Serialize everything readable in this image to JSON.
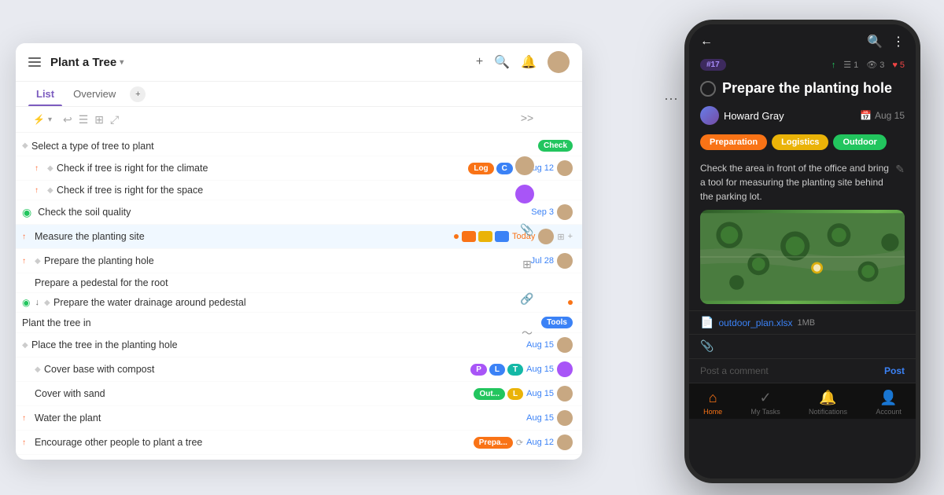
{
  "window": {
    "title": "Plant a Tree",
    "title_chevron": "▾",
    "tabs": [
      {
        "label": "List",
        "active": true
      },
      {
        "label": "Overview",
        "active": false
      }
    ],
    "header_icons": [
      "+",
      "🔍",
      "🔔"
    ],
    "filter_label": "⚡",
    "toolbar_icons": [
      "↩",
      "☰",
      "⊞",
      "⤢"
    ]
  },
  "tasks": [
    {
      "indent": 1,
      "arrow": "",
      "bullet": "◆",
      "name": "Select a type of tree to plant",
      "badge": "Check",
      "badge_color": "green",
      "date": "",
      "avatar": true,
      "avatar_color": "default"
    },
    {
      "indent": 2,
      "arrow": "↑",
      "bullet": "◆",
      "name": "Check if tree is right for the climate",
      "badge": "Log",
      "badge2": "C",
      "badge2_color": "blue",
      "date": "Aug 12",
      "avatar": true,
      "avatar_color": "default",
      "sync": true
    },
    {
      "indent": 2,
      "arrow": "↑",
      "bullet": "◆",
      "name": "Check if tree is right for the space",
      "badge": "",
      "date": "",
      "avatar": false
    },
    {
      "indent": 1,
      "arrow": "",
      "check_green": true,
      "name": "Check the soil quality",
      "date": "Sep 3",
      "avatar": true,
      "avatar_color": "default"
    },
    {
      "indent": 1,
      "arrow": "↑",
      "name": "Measure the planting site",
      "dot": true,
      "badges_color": [
        "orange",
        "orange",
        "blue"
      ],
      "date": "Today",
      "date_color": "orange",
      "avatar": true,
      "avatar_color": "default",
      "actions": true,
      "highlighted": true
    },
    {
      "indent": 1,
      "arrow": "↑",
      "bullet": "◆",
      "name": "Prepare the planting hole",
      "date": "Jul 28",
      "avatar": true,
      "avatar_color": "default"
    },
    {
      "indent": 2,
      "arrow": "",
      "name": "Prepare a pedestal for the root",
      "date": "",
      "avatar": false
    },
    {
      "indent": 1,
      "arrow": "",
      "check_green": true,
      "check_down": true,
      "bullet": "◆",
      "name": "Prepare the water drainage around pedestal",
      "dot_orange": true,
      "date": "",
      "avatar": false
    },
    {
      "indent": 1,
      "arrow": "",
      "name": "Plant the tree in",
      "badge": "Tools",
      "badge_color": "blue",
      "date": "",
      "avatar": false
    },
    {
      "indent": 1,
      "arrow": "",
      "bullet": "◆",
      "name": "Place the tree in the planting hole",
      "date": "Aug 15",
      "avatar": true,
      "avatar_color": "default"
    },
    {
      "indent": 2,
      "arrow": "",
      "bullet": "◆",
      "name": "Cover base with compost",
      "badges": [
        "P",
        "L",
        "T"
      ],
      "badges_colors": [
        "purple",
        "blue",
        "teal"
      ],
      "date": "Aug 15",
      "avatar": true,
      "avatar_color": "purple"
    },
    {
      "indent": 2,
      "arrow": "",
      "name": "Cover with sand",
      "badge": "Out...",
      "badge2": "L",
      "badge2_color": "yellow",
      "date": "Aug 15",
      "avatar": true,
      "avatar_color": "default"
    },
    {
      "indent": 1,
      "arrow": "↑",
      "name": "Water the plant",
      "date": "Aug 15",
      "avatar": true,
      "avatar_color": "default"
    },
    {
      "indent": 1,
      "arrow": "",
      "name": "Encourage other people to plant a tree",
      "badge": "Prepa...",
      "badge_color": "orange",
      "date": "Aug 12",
      "avatar": true,
      "avatar_color": "default",
      "sync": true
    }
  ],
  "phone": {
    "task_id": "#17",
    "stats": {
      "up": "↑",
      "list_count": "1",
      "eye_count": "3",
      "heart_count": "5"
    },
    "task_title": "Prepare the planting hole",
    "assignee": "Howard Gray",
    "date": "Aug 15",
    "calendar_icon": "📅",
    "labels": [
      "Preparation",
      "Logistics",
      "Outdoor"
    ],
    "label_colors": [
      "orange",
      "yellow",
      "green"
    ],
    "description": "Check the area in front of the office and bring a tool for measuring the planting site behind the parking lot.",
    "attachment_name": "outdoor_plan.xlsx",
    "attachment_size": "1MB",
    "comment_placeholder": "Post a comment",
    "post_label": "Post",
    "nav": [
      {
        "icon": "🏠",
        "label": "Home",
        "active": true
      },
      {
        "icon": "✓",
        "label": "My Tasks",
        "active": false
      },
      {
        "icon": "🔔",
        "label": "Notifications",
        "active": false
      },
      {
        "icon": "👤",
        "label": "Account",
        "active": false
      }
    ]
  }
}
